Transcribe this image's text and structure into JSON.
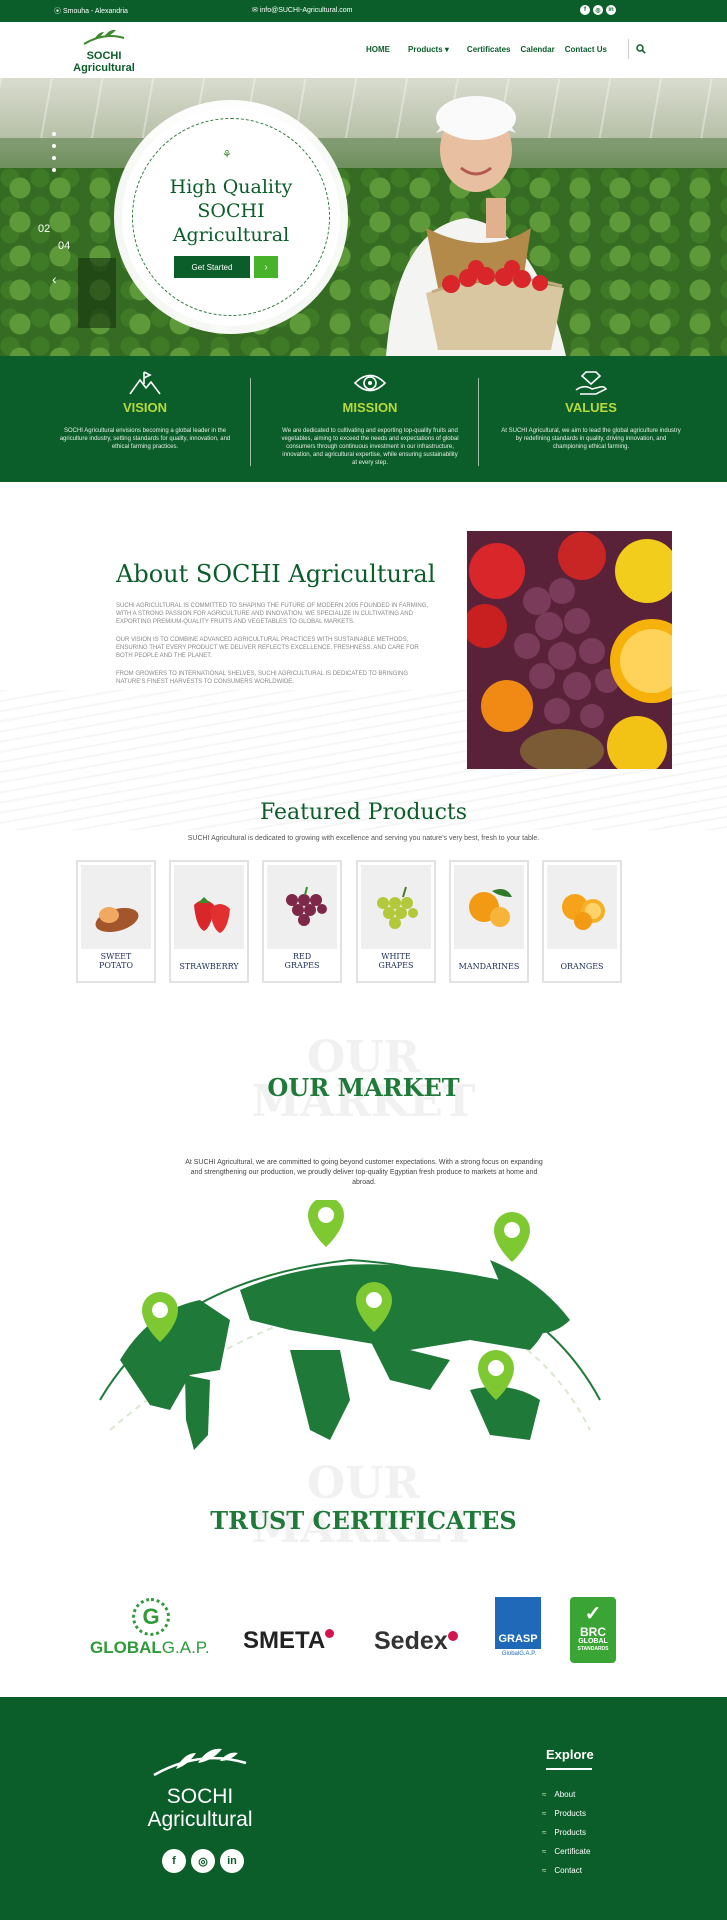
{
  "topbar": {
    "location": "Smouha - Alexandria",
    "email": "info@SUCHI-Agricultural.com",
    "social": [
      "f",
      "◎",
      "in"
    ]
  },
  "header": {
    "logo_line1": "SOCHI",
    "logo_line2": "Agricultural",
    "nav": [
      {
        "label": "HOME"
      },
      {
        "label": "Products"
      },
      {
        "label": "Certificates"
      },
      {
        "label": "Calendar"
      },
      {
        "label": "Contact Us"
      }
    ]
  },
  "hero": {
    "counter_current": "02",
    "counter_total": "04",
    "title_line1": "High Quality",
    "title_line2": "SOCHI",
    "title_line3": "Agricultural",
    "button_label": "Get Started",
    "button_arrow": "›"
  },
  "pillars": [
    {
      "title": "VISION",
      "text": "SOCHI Agricultural envisions becoming a global leader in the agriculture industry, setting standards for quality, innovation, and ethical farming practices."
    },
    {
      "title": "MISSION",
      "text": "We are dedicated to cultivating and exporting top-quality fruits and vegetables, aiming to exceed the needs and expectations of global consumers through continuous investment in our infrastructure, innovation, and agricultural expertise, while ensuring sustainability at every step."
    },
    {
      "title": "VALUES",
      "text": "At SUCHI Agricultural, we aim to lead the global agriculture industry by redefining standards in quality, driving innovation, and championing ethical farming."
    }
  ],
  "about": {
    "title": "About SOCHI Agricultural",
    "p1": "SUCHI AGRICULTURAL IS COMMITTED TO SHAPING THE FUTURE OF MODERN 2005 FOUNDED IN FARMING, WITH A STRONG PASSION FOR AGRICULTURE AND INNOVATION. WE SPECIALIZE IN CULTIVATING AND EXPORTING PREMIUM-QUALITY FRUITS AND VEGETABLES TO GLOBAL MARKETS.",
    "p2": "OUR VISION IS TO COMBINE ADVANCED AGRICULTURAL PRACTICES WITH SUSTAINABLE METHODS, ENSURING THAT EVERY PRODUCT WE DELIVER REFLECTS EXCELLENCE, FRESHNESS, AND CARE FOR BOTH PEOPLE AND THE PLANET.",
    "p3": "FROM GROWERS TO INTERNATIONAL SHELVES, SUCHI AGRICULTURAL IS DEDICATED TO BRINGING NATURE'S FINEST HARVESTS TO CONSUMERS WORLDWIDE."
  },
  "featured": {
    "title": "Featured Products",
    "subtitle": "SUCHI Agricultural is dedicated to growing with excellence and serving you nature's very best, fresh to your table.",
    "products": [
      {
        "label1": "SWEET",
        "label2": "POTATO"
      },
      {
        "label1": "STRAWBERRY",
        "label2": ""
      },
      {
        "label1": "RED",
        "label2": "GRAPES"
      },
      {
        "label1": "WHITE",
        "label2": "GRAPES"
      },
      {
        "label1": "MANDARINES",
        "label2": ""
      },
      {
        "label1": "ORANGES",
        "label2": ""
      }
    ]
  },
  "market": {
    "ghost1": "OUR",
    "ghost2": "MARKET",
    "title": "OUR MARKET",
    "text": "At SUCHI Agricultural, we are committed to going beyond customer expectations. With a strong focus on expanding and strengthening our production, we proudly deliver top-quality Egyptian fresh produce to markets at home and abroad."
  },
  "certificates": {
    "ghost1": "OUR",
    "ghost2": "MARKET",
    "title": "TRUST CERTIFICATES",
    "globalgap_bold": "GLOBAL",
    "globalgap_rest": "G.A.P.",
    "globalgap_mark": "G",
    "smeta": "SMETA",
    "sedex": "Sedex",
    "grasp": "GRASP",
    "grasp_sub": "GlobalG.A.P.",
    "brc1": "BRC",
    "brc2": "GLOBAL",
    "brc3": "STANDARDS"
  },
  "footer": {
    "logo_line1": "SOCHI",
    "logo_line2": "Agricultural",
    "social": [
      "f",
      "◎",
      "in"
    ],
    "explore_title": "Explore",
    "links": [
      "About",
      "Products",
      "Products",
      "Certificate",
      "Contact"
    ]
  },
  "colors": {
    "primary": "#0b5e2a",
    "accent": "#b8d93a",
    "button_accent": "#47b22a"
  }
}
